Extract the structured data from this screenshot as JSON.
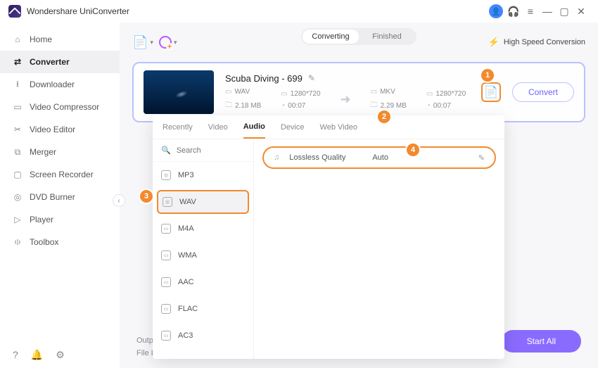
{
  "app": {
    "title": "Wondershare UniConverter"
  },
  "window_controls": {
    "min": "—",
    "max": "▢",
    "close": "✕"
  },
  "sidebar": {
    "items": [
      {
        "label": "Home"
      },
      {
        "label": "Converter"
      },
      {
        "label": "Downloader"
      },
      {
        "label": "Video Compressor"
      },
      {
        "label": "Video Editor"
      },
      {
        "label": "Merger"
      },
      {
        "label": "Screen Recorder"
      },
      {
        "label": "DVD Burner"
      },
      {
        "label": "Player"
      },
      {
        "label": "Toolbox"
      }
    ]
  },
  "toolbar": {
    "seg_converting": "Converting",
    "seg_finished": "Finished",
    "high_speed": "High Speed Conversion"
  },
  "task": {
    "name": "Scuba Diving - 699",
    "src": {
      "format": "WAV",
      "res": "1280*720",
      "size": "2.18 MB",
      "dur": "00:07"
    },
    "dst": {
      "format": "MKV",
      "res": "1280*720",
      "size": "2.29 MB",
      "dur": "00:07"
    },
    "convert_label": "Convert"
  },
  "popover": {
    "tabs": [
      "Recently",
      "Video",
      "Audio",
      "Device",
      "Web Video"
    ],
    "search_placeholder": "Search",
    "formats": [
      "MP3",
      "WAV",
      "M4A",
      "WMA",
      "AAC",
      "FLAC",
      "AC3"
    ],
    "preset": {
      "quality": "Lossless Quality",
      "rate": "Auto"
    }
  },
  "footer": {
    "output": "Output",
    "file_loc": "File Loc"
  },
  "start_all": "Start All",
  "callouts": {
    "c1": "1",
    "c2": "2",
    "c3": "3",
    "c4": "4"
  }
}
